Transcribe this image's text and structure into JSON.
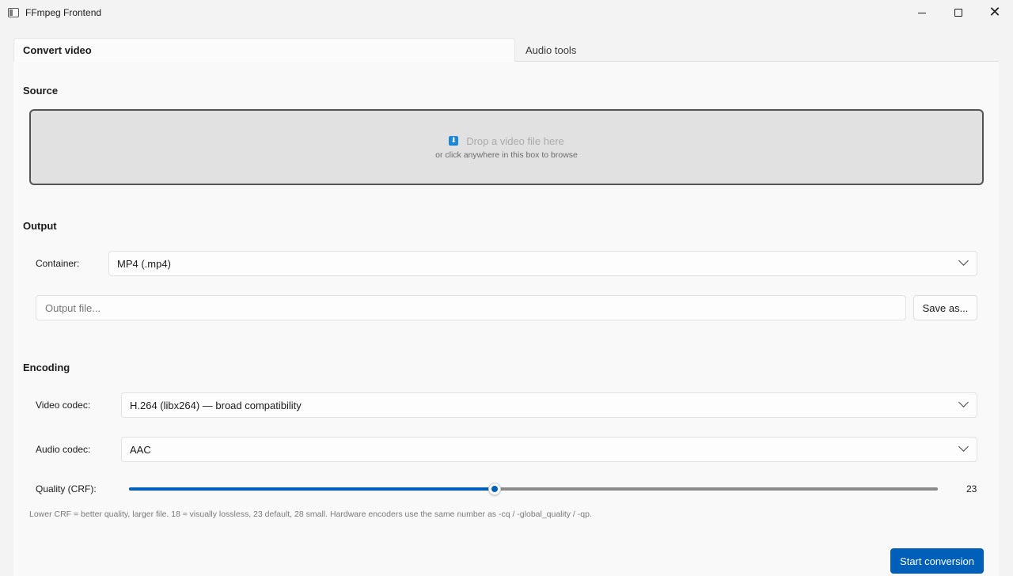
{
  "window": {
    "title": "FFmpeg Frontend",
    "controls": {
      "minimize_icon": "minimize-icon",
      "maximize_icon": "maximize-icon",
      "close_icon": "close-icon"
    }
  },
  "tabs": [
    {
      "label": "Convert video",
      "active": true
    },
    {
      "label": "Audio tools",
      "active": false
    }
  ],
  "source": {
    "title": "Source",
    "dropzone": {
      "icon": "download-arrow-icon",
      "primary": "Drop a video file here",
      "secondary": "or click anywhere in this box to browse"
    }
  },
  "output": {
    "title": "Output",
    "container_label": "Container:",
    "container_value": "MP4 (.mp4)",
    "output_placeholder": "Output file...",
    "output_value": "",
    "save_as_label": "Save as..."
  },
  "encoding": {
    "title": "Encoding",
    "video_codec_label": "Video codec:",
    "video_codec_value": "H.264 (libx264) — broad compatibility",
    "audio_codec_label": "Audio codec:",
    "audio_codec_value": "AAC",
    "quality_label": "Quality (CRF):",
    "quality_value": "23",
    "quality_slider_fraction": 0.452,
    "hint": "Lower CRF = better quality, larger file. 18 ≈ visually lossless, 23 default, 28 small. Hardware encoders use the same number as -cq / -global_quality / -qp."
  },
  "actions": {
    "start_label": "Start conversion"
  },
  "colors": {
    "accent": "#005fb8",
    "dropzone_bg": "#e1e1e1",
    "info_icon": "#1e88d6"
  }
}
